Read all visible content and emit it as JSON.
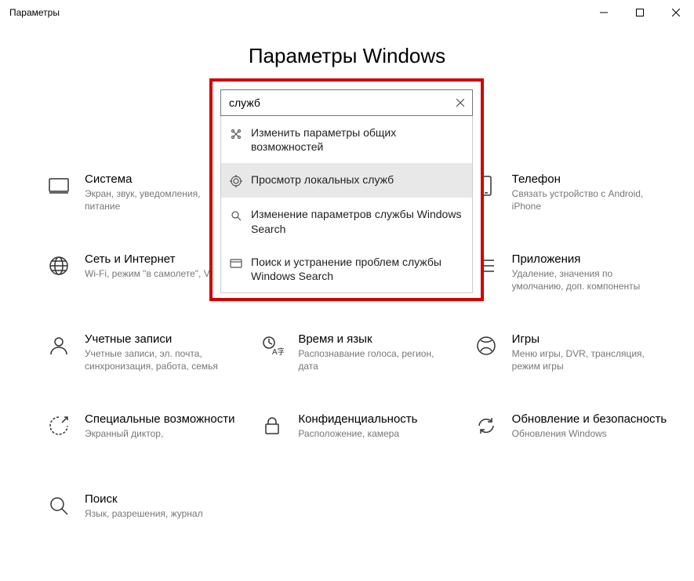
{
  "window": {
    "title": "Параметры"
  },
  "heading": "Параметры Windows",
  "search": {
    "value": "служб",
    "suggestions": [
      {
        "label": "Изменить параметры общих возможностей"
      },
      {
        "label": "Просмотр локальных служб",
        "selected": true
      },
      {
        "label": "Изменение параметров службы Windows Search"
      },
      {
        "label": "Поиск и устранение проблем службы Windows Search"
      }
    ]
  },
  "tiles": {
    "system": {
      "title": "Система",
      "sub": "Экран, звук, уведомления, питание"
    },
    "phone": {
      "title": "Телефон",
      "sub": "Связать устройство с Android, iPhone"
    },
    "network": {
      "title": "Сеть и Интернет",
      "sub": "Wi-Fi, режим \"в самолете\", VPN"
    },
    "apps": {
      "title": "Приложения",
      "sub": "Удаление, значения по умолчанию, доп. компоненты"
    },
    "accounts": {
      "title": "Учетные записи",
      "sub": "Учетные записи, эл. почта, синхронизация, работа, семья"
    },
    "time": {
      "title": "Время и язык",
      "sub": "Распознавание голоса, регион, дата"
    },
    "gaming": {
      "title": "Игры",
      "sub": "Меню игры, DVR, трансляция, режим игры"
    },
    "ease": {
      "title": "Специальные возможности",
      "sub": "Экранный диктор,"
    },
    "privacy": {
      "title": "Конфиденциальность",
      "sub": "Расположение, камера"
    },
    "update": {
      "title": "Обновление и безопасность",
      "sub": "Обновления Windows"
    },
    "searchcat": {
      "title": "Поиск",
      "sub": "Язык, разрешения, журнал"
    }
  }
}
